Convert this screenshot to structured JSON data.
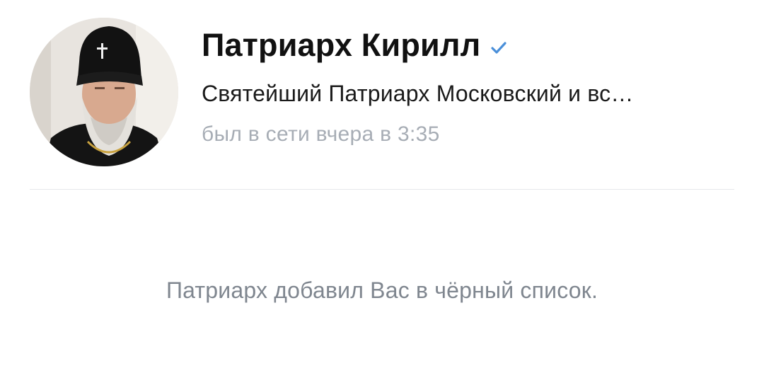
{
  "profile": {
    "name": "Патриарх Кирилл",
    "verified_icon": "verified-check-icon",
    "status": "Святейший Патриарх Московский и вс…",
    "last_seen": "был в сети вчера в 3:35",
    "avatar_icon": "profile-photo"
  },
  "main": {
    "blocked_message": "Патриарх добавил Вас в чёрный список."
  },
  "colors": {
    "verified": "#4a8fd9",
    "secondary_text": "#a7adb5",
    "message_text": "#7f868f"
  }
}
